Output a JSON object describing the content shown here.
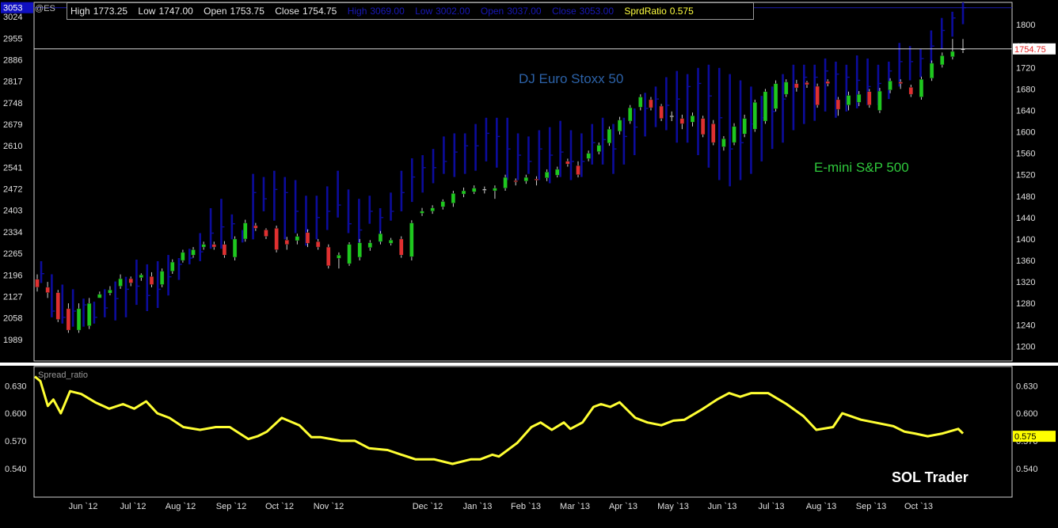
{
  "header": {
    "symbol": "@ES",
    "es": {
      "high_label": "High",
      "high": "1773.25",
      "low_label": "Low",
      "low": "1747.00",
      "open_label": "Open",
      "open": "1753.75",
      "close_label": "Close",
      "close": "1754.75",
      "color": "#e6e6e6"
    },
    "stoxx": {
      "high_label": "High",
      "high": "3069.00",
      "low_label": "Low",
      "low": "3002.00",
      "open_label": "Open",
      "open": "3037.00",
      "close_label": "Close",
      "close": "3053.00",
      "color": "#1818b8"
    },
    "ratio": {
      "label": "SprdRatio",
      "value": "0.575",
      "color": "#ffff40"
    }
  },
  "chart_data": [
    {
      "type": "ohlc",
      "name": "DJ Euro Stoxx 50",
      "axis": "left",
      "ylim": [
        1920,
        3070
      ],
      "y_ticks": [
        1989,
        2058,
        2127,
        2196,
        2265,
        2334,
        2403,
        2472,
        2541,
        2610,
        2679,
        2748,
        2817,
        2886,
        2955,
        3024
      ],
      "last_value_tag": "3053",
      "color": "#0c0c9c",
      "high": [
        2240,
        2198,
        2165,
        2150,
        2120,
        2110,
        2150,
        2175,
        2190,
        2245,
        2230,
        2240,
        2260,
        2250,
        2280,
        2330,
        2410,
        2440,
        2390,
        2340,
        2520,
        2510,
        2530,
        2510,
        2500,
        2450,
        2450,
        2480,
        2530,
        2470,
        2440,
        2450,
        2410,
        2460,
        2530,
        2570,
        2580,
        2600,
        2640,
        2650,
        2650,
        2680,
        2700,
        2700,
        2700,
        2650,
        2640,
        2660,
        2670,
        2690,
        2660,
        2650,
        2680,
        2700,
        2680,
        2700,
        2730,
        2780,
        2800,
        2830,
        2850,
        2840,
        2860,
        2870,
        2860,
        2840,
        2820,
        2800,
        2770,
        2800,
        2840,
        2870,
        2870,
        2870,
        2890,
        2880,
        2870,
        2900,
        2890,
        2870,
        2880,
        2940,
        2930,
        2920,
        2980,
        3020,
        3040,
        3070
      ],
      "low": [
        2170,
        2060,
        2040,
        2030,
        2030,
        2040,
        2060,
        2050,
        2060,
        2100,
        2080,
        2090,
        2130,
        2180,
        2230,
        2240,
        2280,
        2280,
        2310,
        2300,
        2310,
        2400,
        2370,
        2310,
        2330,
        2290,
        2310,
        2340,
        2380,
        2330,
        2300,
        2360,
        2300,
        2370,
        2400,
        2430,
        2460,
        2490,
        2520,
        2510,
        2520,
        2530,
        2560,
        2540,
        2500,
        2500,
        2520,
        2500,
        2490,
        2510,
        2500,
        2510,
        2550,
        2550,
        2520,
        2550,
        2580,
        2640,
        2670,
        2660,
        2620,
        2620,
        2580,
        2540,
        2500,
        2480,
        2500,
        2520,
        2560,
        2600,
        2620,
        2660,
        2680,
        2690,
        2720,
        2700,
        2720,
        2730,
        2740,
        2740,
        2760,
        2800,
        2820,
        2830,
        2860,
        2920,
        2960,
        3000
      ],
      "close": [
        2200,
        2080,
        2060,
        2080,
        2100,
        2060,
        2090,
        2120,
        2150,
        2160,
        2130,
        2150,
        2190,
        2230,
        2250,
        2270,
        2330,
        2350,
        2360,
        2330,
        2460,
        2440,
        2470,
        2460,
        2400,
        2340,
        2380,
        2400,
        2420,
        2360,
        2340,
        2400,
        2380,
        2400,
        2460,
        2510,
        2540,
        2540,
        2560,
        2590,
        2610,
        2610,
        2650,
        2640,
        2600,
        2580,
        2560,
        2600,
        2580,
        2590,
        2560,
        2560,
        2620,
        2630,
        2600,
        2640,
        2670,
        2730,
        2760,
        2740,
        2760,
        2800,
        2810,
        2770,
        2700,
        2600,
        2620,
        2680,
        2700,
        2720,
        2760,
        2800,
        2830,
        2830,
        2850,
        2840,
        2830,
        2820,
        2800,
        2810,
        2850,
        2880,
        2880,
        2890,
        2930,
        2980,
        3020,
        3053
      ]
    },
    {
      "type": "candlestick",
      "name": "E-mini S&P 500",
      "axis": "right",
      "ylim": [
        1172.45,
        1841.55
      ],
      "y_ticks": [
        1200,
        1240,
        1280,
        1320,
        1360,
        1400,
        1440,
        1480,
        1520,
        1560,
        1600,
        1640,
        1680,
        1720,
        1760,
        1800
      ],
      "last_value_tag": "1754.75",
      "up_color": "#1ec81e",
      "down_color": "#e03030",
      "doji_color": "#dddddd",
      "open": [
        1325,
        1310,
        1300,
        1270,
        1230,
        1238,
        1290,
        1299,
        1312,
        1326,
        1328,
        1330,
        1315,
        1340,
        1360,
        1370,
        1385,
        1390,
        1390,
        1366,
        1400,
        1425,
        1417,
        1420,
        1398,
        1397,
        1412,
        1395,
        1385,
        1364,
        1354,
        1366,
        1384,
        1395,
        1392,
        1400,
        1367,
        1448,
        1452,
        1460,
        1467,
        1484,
        1488,
        1493,
        1490,
        1495,
        1509,
        1508,
        1512,
        1514,
        1519,
        1545,
        1537,
        1550,
        1563,
        1579,
        1601,
        1620,
        1646,
        1660,
        1648,
        1630,
        1625,
        1618,
        1625,
        1615,
        1572,
        1580,
        1596,
        1605,
        1620,
        1643,
        1670,
        1690,
        1692,
        1685,
        1694,
        1660,
        1650,
        1655,
        1675,
        1640,
        1678,
        1693,
        1683,
        1665,
        1700,
        1725,
        1740,
        1753.75
      ],
      "close": [
        1310,
        1300,
        1250,
        1230,
        1270,
        1280,
        1297,
        1305,
        1326,
        1318,
        1333,
        1315,
        1340,
        1357,
        1375,
        1380,
        1390,
        1385,
        1370,
        1400,
        1430,
        1420,
        1405,
        1380,
        1390,
        1405,
        1392,
        1385,
        1350,
        1370,
        1390,
        1393,
        1393,
        1410,
        1398,
        1370,
        1430,
        1452,
        1458,
        1470,
        1485,
        1490,
        1495,
        1492,
        1495,
        1515,
        1507,
        1515,
        1510,
        1525,
        1530,
        1540,
        1520,
        1560,
        1575,
        1605,
        1622,
        1645,
        1665,
        1645,
        1625,
        1630,
        1615,
        1630,
        1595,
        1580,
        1587,
        1610,
        1625,
        1655,
        1675,
        1690,
        1693,
        1682,
        1688,
        1650,
        1690,
        1642,
        1668,
        1670,
        1650,
        1676,
        1695,
        1690,
        1670,
        1698,
        1728,
        1742,
        1750,
        1754.75
      ],
      "high": [
        1334,
        1320,
        1305,
        1280,
        1280,
        1290,
        1302,
        1312,
        1334,
        1330,
        1336,
        1338,
        1345,
        1362,
        1380,
        1385,
        1395,
        1395,
        1396,
        1405,
        1436,
        1430,
        1420,
        1425,
        1404,
        1410,
        1418,
        1400,
        1390,
        1375,
        1394,
        1400,
        1398,
        1415,
        1402,
        1405,
        1435,
        1458,
        1463,
        1474,
        1490,
        1496,
        1500,
        1498,
        1500,
        1520,
        1513,
        1520,
        1517,
        1530,
        1535,
        1550,
        1545,
        1565,
        1580,
        1610,
        1628,
        1650,
        1670,
        1665,
        1652,
        1638,
        1632,
        1636,
        1630,
        1622,
        1592,
        1616,
        1632,
        1660,
        1680,
        1696,
        1698,
        1697,
        1695,
        1690,
        1698,
        1665,
        1675,
        1676,
        1680,
        1682,
        1700,
        1698,
        1688,
        1703,
        1733,
        1748,
        1773.25,
        1773.25
      ],
      "low": [
        1302,
        1290,
        1245,
        1225,
        1225,
        1232,
        1290,
        1295,
        1307,
        1312,
        1322,
        1310,
        1310,
        1335,
        1356,
        1365,
        1380,
        1380,
        1365,
        1360,
        1395,
        1415,
        1400,
        1375,
        1380,
        1390,
        1385,
        1380,
        1345,
        1345,
        1350,
        1360,
        1378,
        1390,
        1388,
        1365,
        1360,
        1443,
        1447,
        1455,
        1460,
        1478,
        1484,
        1485,
        1475,
        1490,
        1500,
        1503,
        1500,
        1508,
        1515,
        1535,
        1515,
        1545,
        1558,
        1574,
        1595,
        1615,
        1640,
        1640,
        1620,
        1620,
        1605,
        1610,
        1590,
        1575,
        1565,
        1575,
        1590,
        1600,
        1615,
        1638,
        1665,
        1675,
        1682,
        1645,
        1685,
        1630,
        1640,
        1648,
        1645,
        1635,
        1672,
        1680,
        1665,
        1660,
        1695,
        1720,
        1735,
        1747.0
      ]
    },
    {
      "type": "line",
      "name": "Spread_ratio",
      "ylim": [
        0.5088,
        0.6509
      ],
      "y_ticks": [
        0.54,
        0.57,
        0.6,
        0.63
      ],
      "y_tick_labels": [
        "0.540",
        "0.570",
        "0.600",
        "0.630"
      ],
      "last_value_tag": "0.575",
      "color": "#ffff33",
      "x": [
        0,
        0.006,
        0.014,
        0.02,
        0.028,
        0.038,
        0.05,
        0.065,
        0.08,
        0.095,
        0.107,
        0.12,
        0.132,
        0.145,
        0.16,
        0.178,
        0.195,
        0.21,
        0.23,
        0.24,
        0.25,
        0.266,
        0.285,
        0.298,
        0.308,
        0.33,
        0.345,
        0.36,
        0.38,
        0.395,
        0.41,
        0.43,
        0.45,
        0.47,
        0.48,
        0.493,
        0.5,
        0.52,
        0.535,
        0.545,
        0.557,
        0.57,
        0.577,
        0.59,
        0.602,
        0.61,
        0.62,
        0.63,
        0.647,
        0.66,
        0.675,
        0.688,
        0.7,
        0.72,
        0.735,
        0.748,
        0.76,
        0.772,
        0.79,
        0.81,
        0.828,
        0.842,
        0.86,
        0.87,
        0.89,
        0.905,
        0.925,
        0.937,
        0.948,
        0.962,
        0.978,
        0.995,
        1
      ],
      "y": [
        0.64,
        0.635,
        0.608,
        0.615,
        0.6,
        0.624,
        0.621,
        0.612,
        0.605,
        0.61,
        0.605,
        0.613,
        0.6,
        0.595,
        0.585,
        0.582,
        0.585,
        0.585,
        0.572,
        0.575,
        0.58,
        0.595,
        0.587,
        0.574,
        0.574,
        0.57,
        0.57,
        0.562,
        0.56,
        0.555,
        0.55,
        0.55,
        0.545,
        0.55,
        0.55,
        0.555,
        0.553,
        0.568,
        0.585,
        0.59,
        0.582,
        0.59,
        0.583,
        0.59,
        0.607,
        0.61,
        0.607,
        0.612,
        0.595,
        0.59,
        0.587,
        0.592,
        0.593,
        0.605,
        0.615,
        0.622,
        0.618,
        0.622,
        0.622,
        0.61,
        0.597,
        0.582,
        0.585,
        0.6,
        0.593,
        0.59,
        0.586,
        0.58,
        0.578,
        0.575,
        0.578,
        0.583,
        0.578
      ]
    }
  ],
  "x_axis": {
    "labels": [
      "Jun `12",
      "Jul `12",
      "Aug `12",
      "Sep `12",
      "Oct `12",
      "Nov `12",
      "Dec `12",
      "Jan `13",
      "Feb `13",
      "Mar `13",
      "Apr `13",
      "May `13",
      "Jun `13",
      "Jul `13",
      "Aug `13",
      "Sep `13",
      "Oct `13"
    ]
  },
  "annotations": {
    "stoxx_label": "DJ Euro Stoxx 50",
    "es_label": "E-mini S&P 500",
    "indicator_title": "Spread_ratio",
    "watermark": "SOL Trader"
  },
  "colors": {
    "background": "#000000",
    "frame": "#cfcfcf",
    "separator": "#ffffff",
    "stoxx_label": "#2c62a8",
    "es_label": "#2fc83c",
    "tick_text": "#e0e0e0"
  }
}
